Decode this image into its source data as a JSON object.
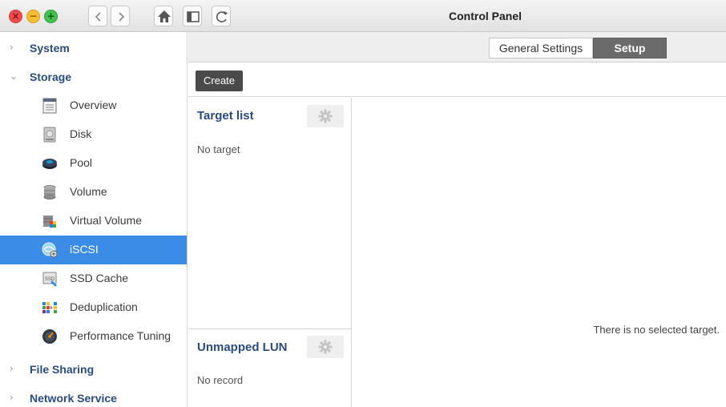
{
  "window": {
    "title": "Control Panel",
    "controls": {
      "close": "×",
      "minimize": "−",
      "maximize": "+"
    }
  },
  "toolbar_icons": [
    "chevron-left-icon",
    "chevron-right-icon",
    "home-icon",
    "sidebar-toggle-icon",
    "refresh-icon"
  ],
  "sidebar": {
    "groups": [
      {
        "label": "System",
        "expanded": false
      },
      {
        "label": "Storage",
        "expanded": true
      },
      {
        "label": "File Sharing",
        "expanded": false
      },
      {
        "label": "Network Service",
        "expanded": false
      }
    ],
    "storage_items": [
      {
        "label": "Overview",
        "icon": "overview-icon"
      },
      {
        "label": "Disk",
        "icon": "disk-icon"
      },
      {
        "label": "Pool",
        "icon": "pool-icon"
      },
      {
        "label": "Volume",
        "icon": "volume-icon"
      },
      {
        "label": "Virtual Volume",
        "icon": "virtual-volume-icon"
      },
      {
        "label": "iSCSI",
        "icon": "iscsi-icon",
        "active": true
      },
      {
        "label": "SSD Cache",
        "icon": "ssd-cache-icon"
      },
      {
        "label": "Deduplication",
        "icon": "deduplication-icon"
      },
      {
        "label": "Performance Tuning",
        "icon": "performance-tuning-icon"
      }
    ]
  },
  "tabs": [
    {
      "label": "General Settings",
      "active": false
    },
    {
      "label": "Setup",
      "active": true
    }
  ],
  "actions": {
    "create_label": "Create"
  },
  "target_list": {
    "title": "Target list",
    "empty": "No target"
  },
  "unmapped_lun": {
    "title": "Unmapped LUN",
    "empty": "No record"
  },
  "detail": {
    "empty_message": "There is no selected target."
  },
  "colors": {
    "accent": "#3b8ce6",
    "heading": "#2a4c80",
    "tab_active": "#6b6b6b"
  }
}
